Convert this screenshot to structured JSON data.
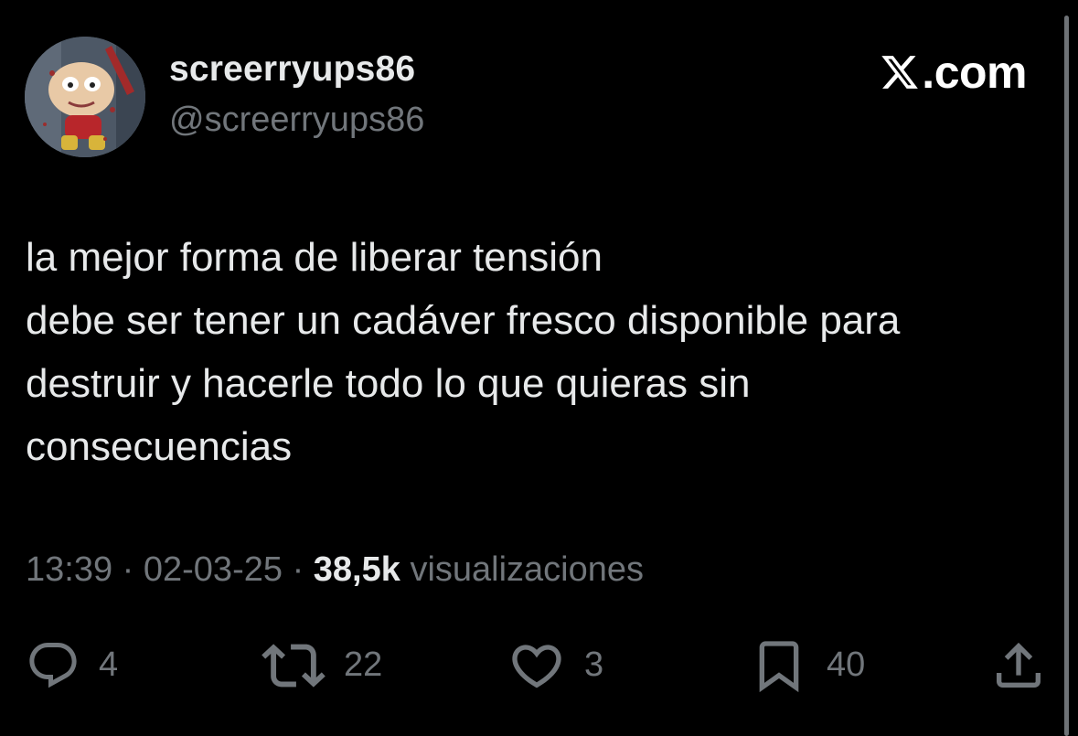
{
  "author": {
    "display_name": "screerryups86",
    "handle": "@screerryups86"
  },
  "brand": {
    "text": ".com"
  },
  "tweet": {
    "lines": [
      "la mejor forma de liberar tensión",
      "debe ser tener un cadáver fresco disponible para",
      "destruir y hacerle todo lo que quieras sin",
      "consecuencias"
    ]
  },
  "meta": {
    "time": "13:39",
    "separator": "·",
    "date": "02-03-25",
    "views_count": "38,5k",
    "views_label": "visualizaciones"
  },
  "actions": {
    "replies": "4",
    "reposts": "22",
    "likes": "3",
    "bookmarks": "40"
  },
  "icons": {
    "reply": "reply-icon",
    "repost": "repost-icon",
    "like": "heart-icon",
    "bookmark": "bookmark-icon",
    "share": "share-icon",
    "brand": "x-logo-icon"
  },
  "colors": {
    "background": "#000000",
    "primary_text": "#e7e9ea",
    "secondary_text": "#71767b"
  }
}
